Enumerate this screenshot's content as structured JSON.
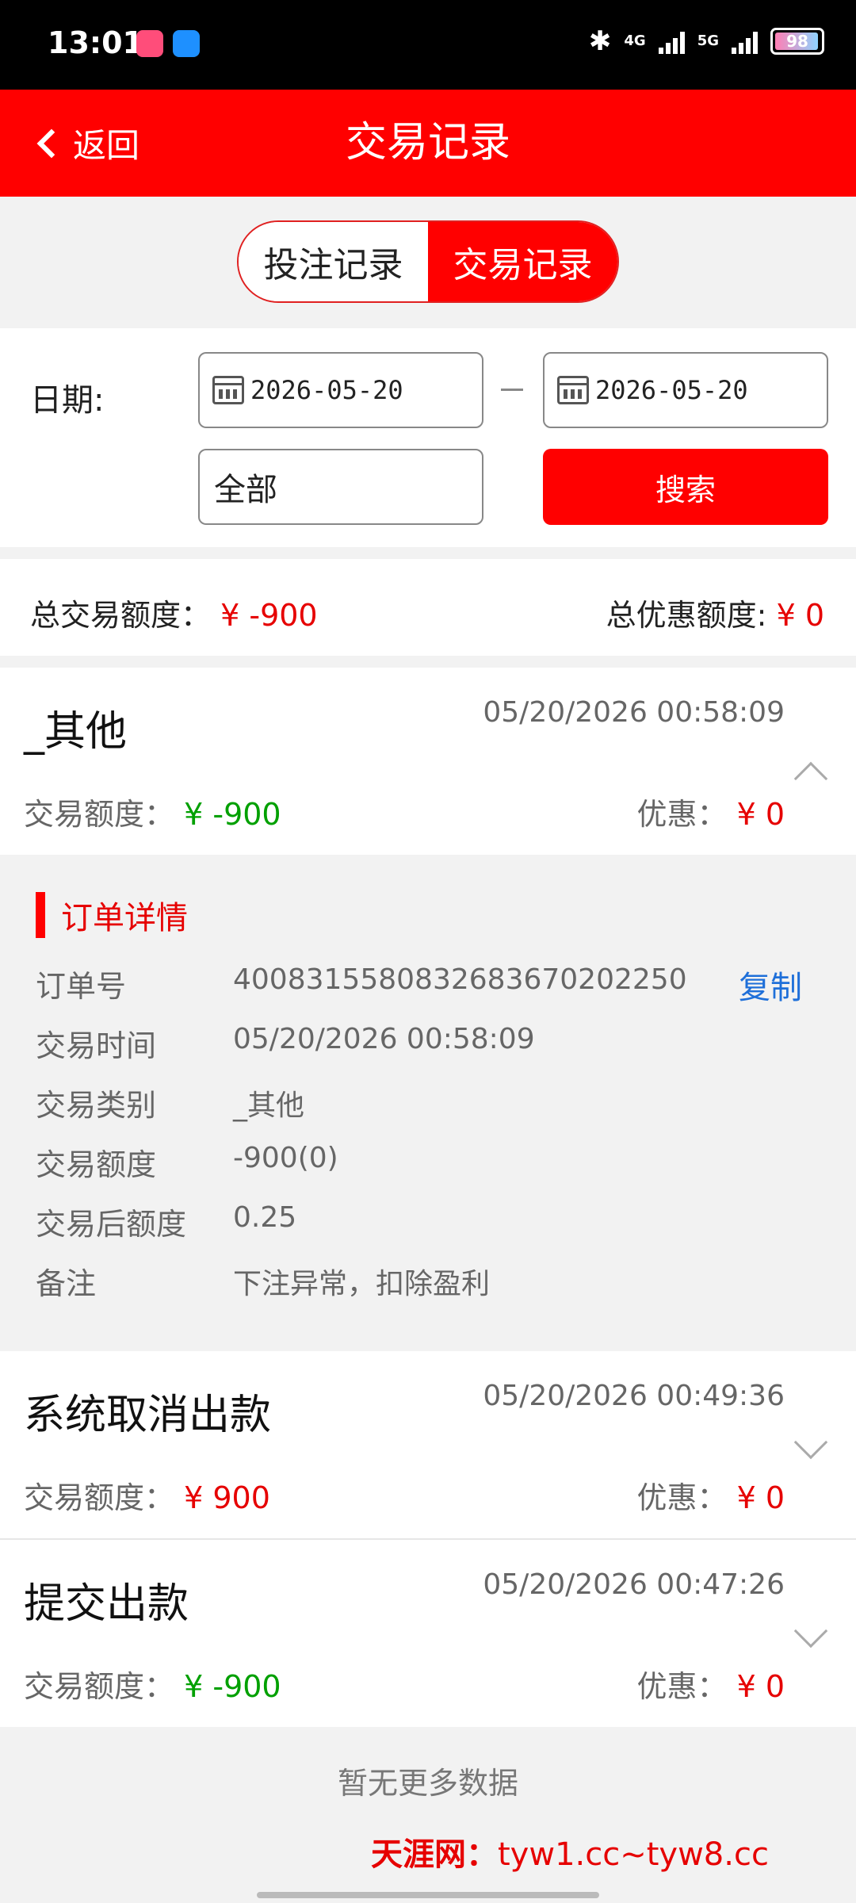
{
  "status_bar": {
    "time": "13:01",
    "net_a": "4G",
    "net_b": "5G",
    "battery": "98"
  },
  "nav": {
    "back_label": "返回",
    "title": "交易记录"
  },
  "segment": {
    "tab_bet": "投注记录",
    "tab_trade": "交易记录"
  },
  "filter": {
    "date_label": "日期:",
    "start_date": "2026-05-20",
    "end_date": "2026-05-20",
    "type_value": "全部",
    "search_label": "搜索"
  },
  "summary": {
    "total_label": "总交易额度：",
    "total_value": "¥ -900",
    "discount_label": "总优惠额度:",
    "discount_value": "¥ 0"
  },
  "records": [
    {
      "title": "_其他",
      "time": "05/20/2026 00:58:09",
      "amount_label": "交易额度：",
      "amount": "¥ -900",
      "disc_label": "优惠：",
      "disc": "¥ 0"
    },
    {
      "title": "系统取消出款",
      "time": "05/20/2026 00:49:36",
      "amount_label": "交易额度：",
      "amount": "¥ 900",
      "disc_label": "优惠：",
      "disc": "¥ 0"
    },
    {
      "title": "提交出款",
      "time": "05/20/2026 00:47:26",
      "amount_label": "交易额度：",
      "amount": "¥ -900",
      "disc_label": "优惠：",
      "disc": "¥ 0"
    }
  ],
  "details": {
    "heading": "订单详情",
    "copy_label": "复制",
    "rows": [
      {
        "label": "订单号",
        "value": "4008315580832683670202250"
      },
      {
        "label": "交易时间",
        "value": "05/20/2026 00:58:09"
      },
      {
        "label": "交易类别",
        "value": "_其他"
      },
      {
        "label": "交易额度",
        "value": "-900(0)"
      },
      {
        "label": "交易后额度",
        "value": "0.25"
      },
      {
        "label": "备注",
        "value": "下注异常，扣除盈利"
      }
    ]
  },
  "footer": {
    "no_more": "暂无更多数据"
  },
  "watermark": {
    "brand": "天涯网：",
    "domains": "tyw1.cc~tyw8.cc"
  }
}
